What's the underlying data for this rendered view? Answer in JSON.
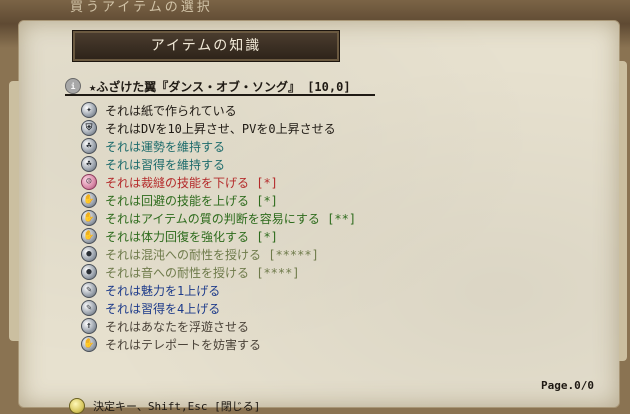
{
  "background": {
    "title": "買うアイテムの選択"
  },
  "window": {
    "title": "アイテムの知識"
  },
  "item": {
    "name": "★ふざけた翼『ダンス・オブ・ソング』 [10,0]"
  },
  "properties": [
    {
      "text": "それは紙で作られている",
      "color": "#1f1a14",
      "icon": "paper-icon",
      "glyph": "✦"
    },
    {
      "text": "それはDVを10上昇させ、PVを0上昇させる",
      "color": "#1f1a14",
      "icon": "armor-icon",
      "glyph": "⛨"
    },
    {
      "text": "それは運勢を維持する",
      "color": "#1c6b6b",
      "icon": "luck-icon",
      "glyph": "☘"
    },
    {
      "text": "それは習得を維持する",
      "color": "#1c6b6b",
      "icon": "learning-icon",
      "glyph": "☘"
    },
    {
      "text": "それは裁縫の技能を下げる [*]",
      "color": "#b42a2a",
      "icon": "curse-icon",
      "glyph": "☹"
    },
    {
      "text": "それは回避の技能を上げる [*]",
      "color": "#2d6b1c",
      "icon": "skill-icon",
      "glyph": "✋"
    },
    {
      "text": "それはアイテムの質の判断を容易にする [**]",
      "color": "#2d6b1c",
      "icon": "skill-icon",
      "glyph": "✋"
    },
    {
      "text": "それは体力回復を強化する [*]",
      "color": "#2d6b1c",
      "icon": "skill-icon",
      "glyph": "✋"
    },
    {
      "text": "それは混沌への耐性を授ける [*****]",
      "color": "#6e7a4a",
      "icon": "resist-icon",
      "glyph": "●"
    },
    {
      "text": "それは音への耐性を授ける [****]",
      "color": "#6e7a4a",
      "icon": "resist-icon",
      "glyph": "●"
    },
    {
      "text": "それは魅力を1上げる",
      "color": "#1c3a8a",
      "icon": "attribute-icon",
      "glyph": "✎"
    },
    {
      "text": "それは習得を4上げる",
      "color": "#1c3a8a",
      "icon": "attribute-icon",
      "glyph": "✎"
    },
    {
      "text": "それはあなたを浮遊させる",
      "color": "#4a4238",
      "icon": "float-icon",
      "glyph": "↑"
    },
    {
      "text": "それはテレポートを妨害する",
      "color": "#4a4238",
      "icon": "teleport-icon",
      "glyph": "✋"
    }
  ],
  "page": "Page.0/0",
  "footer": {
    "hint": "決定キー、Shift,Esc [閉じる]"
  }
}
